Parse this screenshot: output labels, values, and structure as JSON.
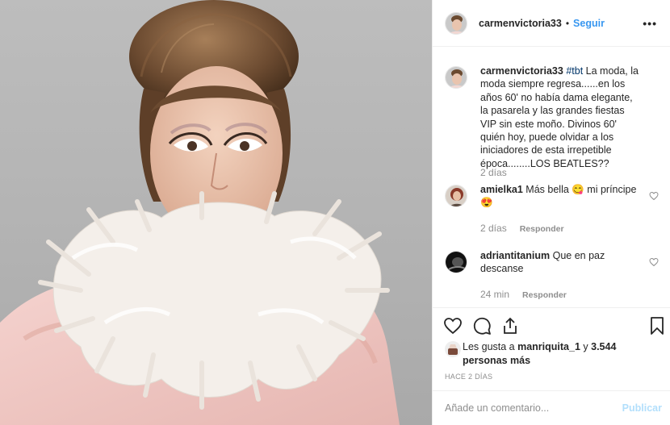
{
  "header": {
    "username": "carmenvictoria33",
    "separator": "•",
    "follow_label": "Seguir",
    "more_label": "•••"
  },
  "caption": {
    "username": "carmenvictoria33",
    "hashtag": "#tbt",
    "text": " La moda, la moda siempre regresa......en los años 60' no había dama elegante, la pasarela y las grandes fiestas VIP sin este moño. Divinos 60' quién hoy, puede olvidar a los iniciadores de esta irrepetible época........LOS BEATLES??",
    "time": "2 días"
  },
  "comments": [
    {
      "username": "amielka1",
      "text": " Más bella 😋 mi príncipe 😍",
      "time": "2 días",
      "reply_label": "Responder"
    },
    {
      "username": "adriantitanium",
      "text": " Que en paz descanse",
      "time": "24 min",
      "reply_label": "Responder"
    }
  ],
  "likes": {
    "prefix": "Les gusta a ",
    "user": "manriquita_1",
    "middle": " y ",
    "count": "3.544 personas más"
  },
  "timestamp": "HACE 2 DÍAS",
  "add_comment": {
    "placeholder": "Añade un comentario...",
    "publish_label": "Publicar"
  },
  "icons": {
    "like": "heart-icon",
    "comment": "comment-bubble-icon",
    "share": "share-icon",
    "save": "bookmark-icon",
    "more": "more-options-icon"
  },
  "colors": {
    "link": "#3897f0",
    "hashtag": "#003569",
    "muted": "#8e8e8e",
    "publish_disabled": "#b2dffc"
  }
}
